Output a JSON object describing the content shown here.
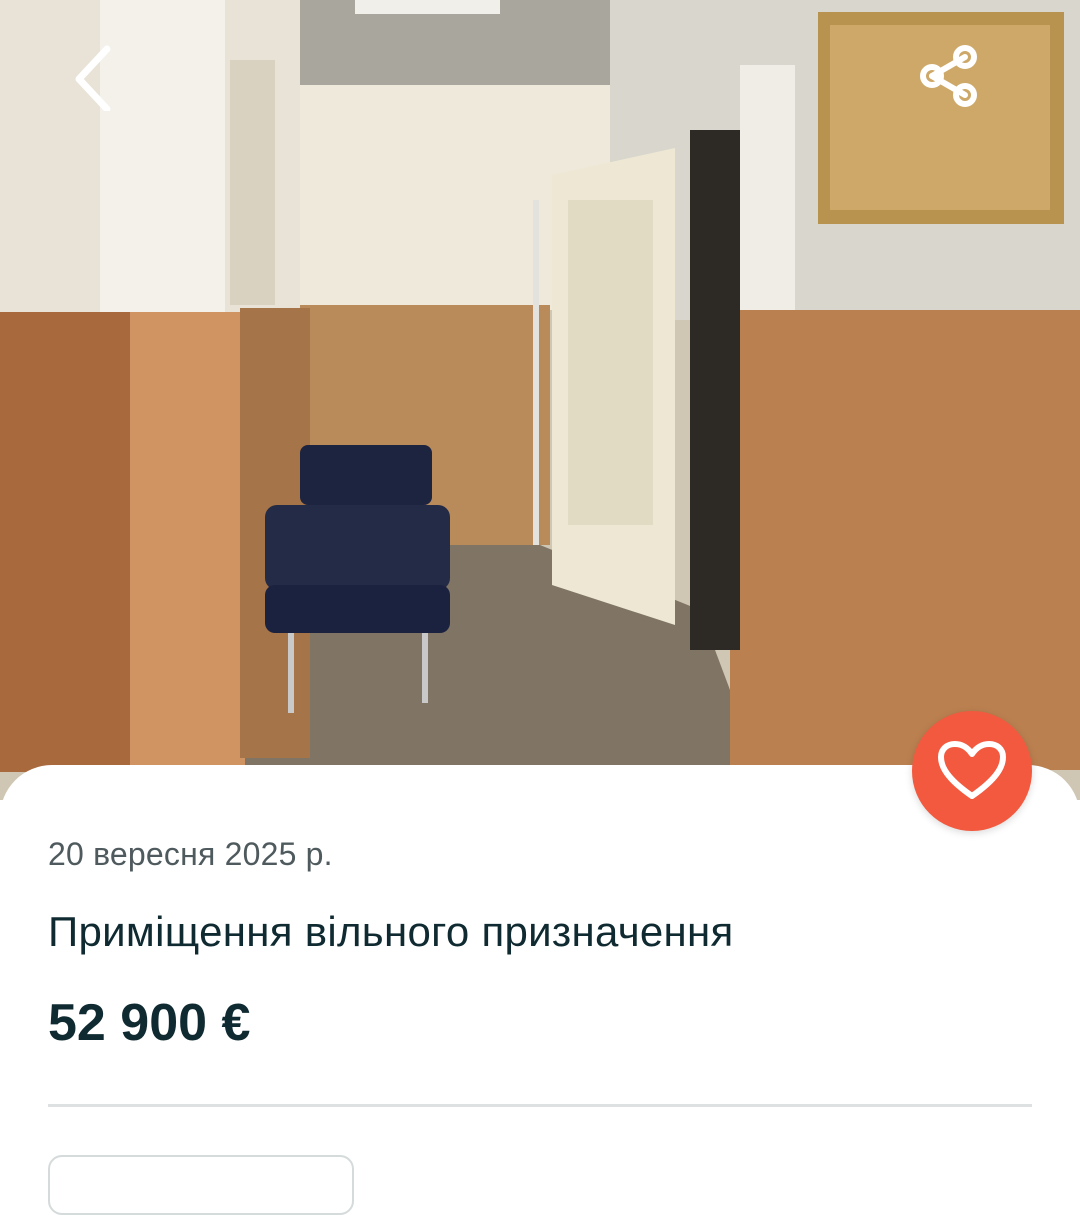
{
  "listing": {
    "photo": {
      "kind": "property-photo"
    },
    "date": "20 вересня 2025 р.",
    "title": "Приміщення вільного призначення",
    "price": "52 900 €"
  },
  "toolbar": {
    "back_icon": "chevron-left-icon",
    "share_icon": "share-icon"
  },
  "favorite": {
    "icon": "heart-icon",
    "color": "#f2593f"
  },
  "colors": {
    "text_dark": "#0f2a31",
    "text_muted": "#4f5a5e",
    "divider": "#dde1e2"
  }
}
